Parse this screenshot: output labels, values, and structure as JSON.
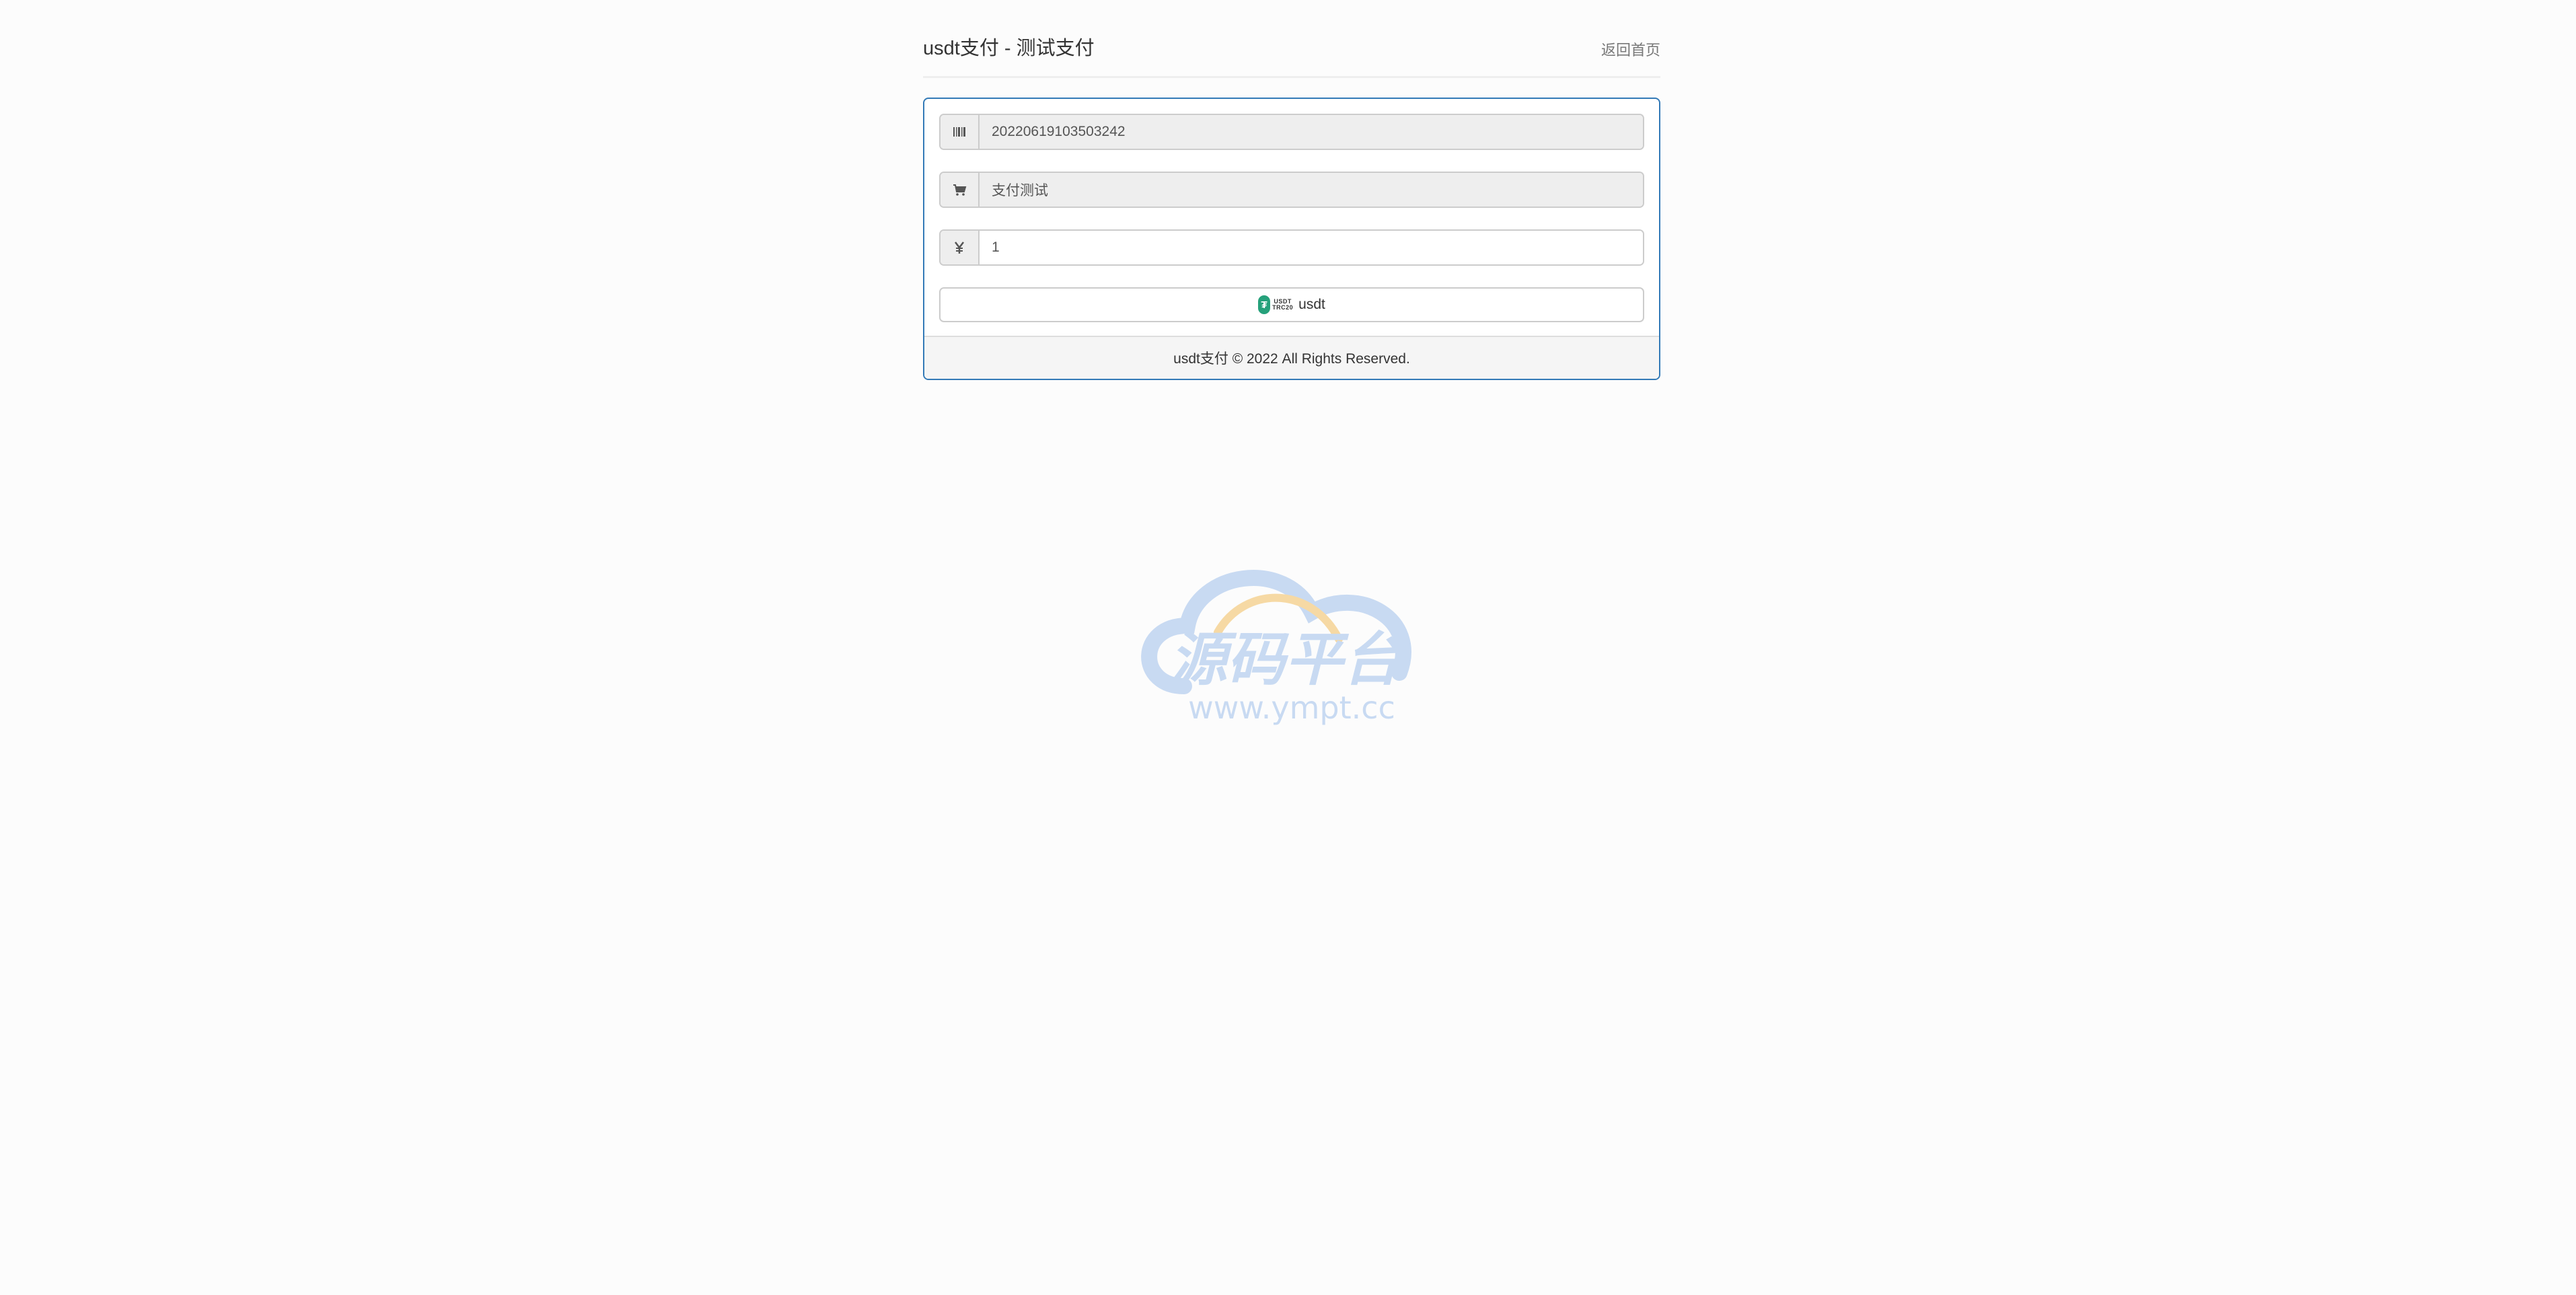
{
  "header": {
    "title": "usdt支付 - 测试支付",
    "home_link": "返回首页"
  },
  "form": {
    "order_no": {
      "icon": "barcode-icon",
      "value": "20220619103503242"
    },
    "product_name": {
      "icon": "shopping-cart-icon",
      "value": "支付测试"
    },
    "amount": {
      "icon": "yen-icon",
      "value": "1"
    },
    "pay_button": {
      "logo_tag_top": "USDT",
      "logo_tag_bottom": "TRC20",
      "coin_symbol": "₮",
      "label": "usdt"
    }
  },
  "footer": {
    "text": "usdt支付 © 2022 All Rights Reserved."
  },
  "watermark": {
    "title": "源码平台",
    "url": "www.ympt.cc"
  },
  "colors": {
    "panel_border": "#337ab7",
    "coin": "#26a17b",
    "watermark_blue": "#c8daf2",
    "watermark_orange": "#f6d9a4"
  }
}
